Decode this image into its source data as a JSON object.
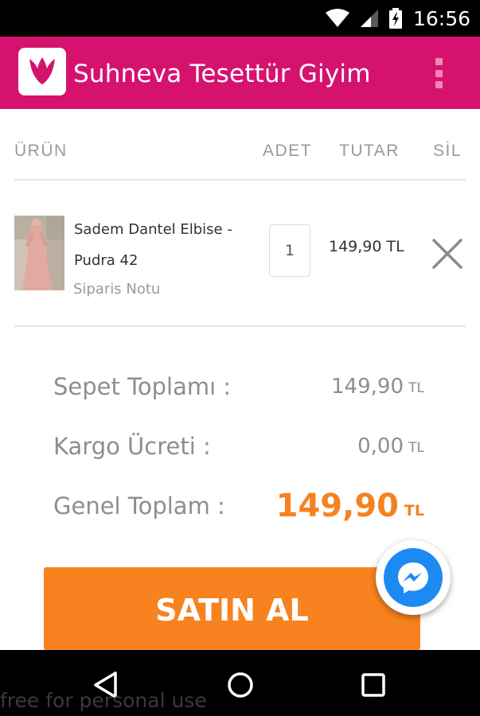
{
  "status_bar": {
    "time": "16:56",
    "icons": [
      "wifi-icon",
      "signal-icon",
      "battery-charging-icon"
    ]
  },
  "app_bar": {
    "title": "Suhneva Tesettür Giyim",
    "logo_icon": "tulip-logo-icon",
    "menu_icon": "overflow-menu-icon",
    "color": "#d5136e"
  },
  "cart": {
    "headers": {
      "product": "ÜRÜN",
      "quantity": "ADET",
      "amount": "TUTAR",
      "delete": "SİL"
    },
    "items": [
      {
        "name": "Sadem Dantel Elbise - Pudra 42",
        "note_link": "Siparis Notu",
        "quantity": "1",
        "price": "149,90 TL",
        "remove_icon": "close-icon"
      }
    ]
  },
  "totals": {
    "subtotal_label": "Sepet Toplamı :",
    "subtotal_value": "149,90",
    "shipping_label": "Kargo Ücreti :",
    "shipping_value": "0,00",
    "grand_total_label": "Genel Toplam :",
    "grand_total_value": "149,90",
    "currency": "TL",
    "accent_color": "#f58220"
  },
  "checkout": {
    "buy_label": "SATIN AL",
    "button_color": "#f7821f"
  },
  "messenger": {
    "icon": "messenger-icon",
    "color": "#1d8af4"
  },
  "nav_bar": {
    "icons": [
      "back-icon",
      "home-icon",
      "recents-icon"
    ]
  },
  "watermark": "free for personal use"
}
